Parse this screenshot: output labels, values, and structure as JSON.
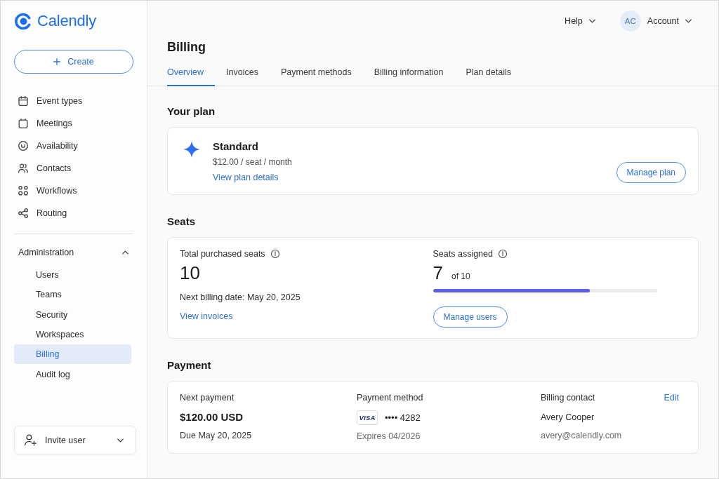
{
  "sidebar": {
    "logo": "Calendly",
    "create_button": "Create",
    "nav_items": [
      {
        "label": "Event types",
        "selected": false
      },
      {
        "label": "Meetings",
        "selected": false
      },
      {
        "label": "Availability",
        "selected": false
      },
      {
        "label": "Contacts",
        "selected": false
      },
      {
        "label": "Workflows",
        "selected": false
      },
      {
        "label": "Routing",
        "selected": false
      }
    ],
    "admin": {
      "label": "Administration",
      "expanded": true,
      "items": [
        {
          "label": "Users",
          "selected": false
        },
        {
          "label": "Teams",
          "selected": false
        },
        {
          "label": "Security",
          "selected": false
        },
        {
          "label": "Workspaces",
          "selected": false
        },
        {
          "label": "Billing",
          "selected": true
        },
        {
          "label": "Audit log",
          "selected": false
        }
      ]
    },
    "invite_button": "Invite user"
  },
  "header": {
    "help": "Help",
    "account": {
      "initials": "AC",
      "label": "Account"
    }
  },
  "title": "Billing",
  "tabs": [
    {
      "label": "Overview",
      "selected": true
    },
    {
      "label": "Invoices",
      "selected": false
    },
    {
      "label": "Payment methods",
      "selected": false
    },
    {
      "label": "Billing information",
      "selected": false
    },
    {
      "label": "Plan details",
      "selected": false
    }
  ],
  "plan": {
    "heading": "Your plan",
    "name": "Standard",
    "price": "$12.00 / seat / month",
    "details_link": "View plan details",
    "manage_button": "Manage plan"
  },
  "seats": {
    "heading": "Seats",
    "purchased": {
      "label": "Total purchased seats",
      "count": "10",
      "next_billing": "Next billing date: May 20, 2025",
      "invoices_link": "View invoices"
    },
    "assigned": {
      "label": "Seats assigned",
      "count": "7",
      "total": "of 10",
      "level": 0.7,
      "manage_button": "Manage users"
    }
  },
  "payment": {
    "heading": "Payment",
    "next_payment": {
      "label": "Next payment",
      "amount": "$120.00 USD",
      "due": "Due May 20, 2025"
    },
    "method": {
      "label": "Payment method",
      "brand": "VISA",
      "number": "•••• 4282",
      "expires": "Expires 04/2026"
    },
    "contact": {
      "label": "Billing contact",
      "edit_link": "Edit",
      "name": "Avery Cooper",
      "email": "avery@calendly.com"
    }
  }
}
